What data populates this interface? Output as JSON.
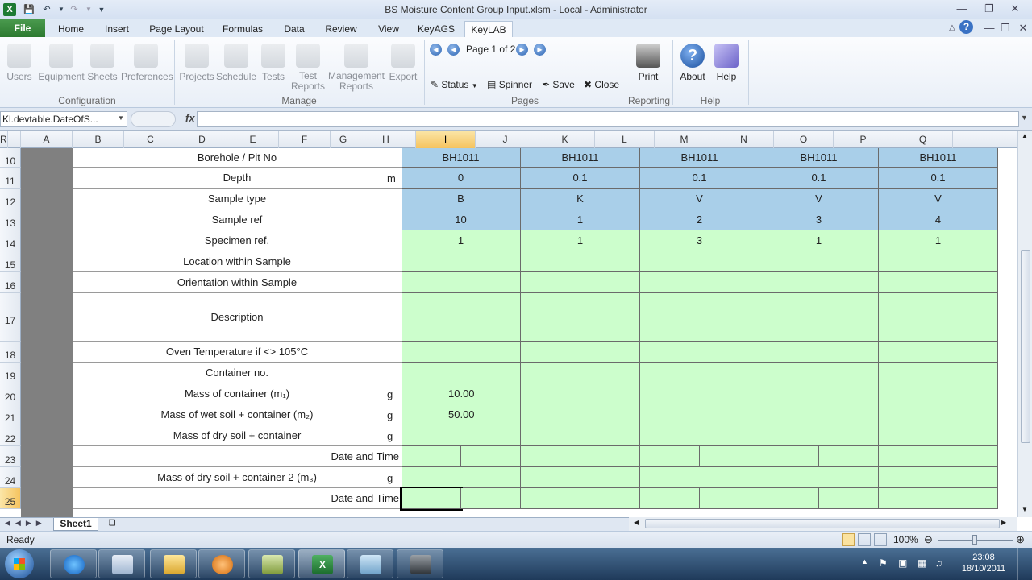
{
  "window": {
    "title": "BS Moisture Content Group Input.xlsm  -  Local - Administrator",
    "app_icon": "excel-icon",
    "buttons": [
      "minimize",
      "restore",
      "close"
    ]
  },
  "tabs": [
    "File",
    "Home",
    "Insert",
    "Page Layout",
    "Formulas",
    "Data",
    "Review",
    "View",
    "KeyAGS",
    "KeyLAB"
  ],
  "active_tab": "KeyLAB",
  "ribbon": {
    "configuration": {
      "group": "Configuration",
      "buttons": [
        "Users",
        "Equipment",
        "Sheets",
        "Preferences"
      ]
    },
    "manage": {
      "group": "Manage",
      "buttons": [
        "Projects",
        "Schedule",
        "Tests",
        "Test Reports",
        "Management Reports",
        "Export"
      ]
    },
    "pages": {
      "group": "Pages",
      "page_label": "Page 1 of 2",
      "status": "Status",
      "spinner": "Spinner",
      "save": "Save",
      "close": "Close"
    },
    "reporting": {
      "group": "Reporting",
      "print": "Print"
    },
    "help": {
      "group": "Help",
      "about": "About",
      "help": "Help"
    }
  },
  "formula_bar": {
    "name_box": "Kl.devtable.DateOfS...",
    "fx": "fx",
    "value": ""
  },
  "columns": [
    "A",
    "B",
    "C",
    "D",
    "E",
    "F",
    "G",
    "H",
    "I",
    "J",
    "K",
    "L",
    "M",
    "N",
    "O",
    "P",
    "Q",
    "R"
  ],
  "selected_column": "I",
  "selected_row": "25",
  "rows": [
    {
      "num": "10",
      "label": "Borehole / Pit No",
      "unit": "",
      "values": [
        "BH1011",
        "BH1011",
        "BH1011",
        "BH1011",
        "BH1011"
      ]
    },
    {
      "num": "11",
      "label": "Depth",
      "unit": "m",
      "values": [
        "0",
        "0.1",
        "0.1",
        "0.1",
        "0.1"
      ]
    },
    {
      "num": "12",
      "label": "Sample type",
      "unit": "",
      "values": [
        "B",
        "K",
        "V",
        "V",
        "V"
      ]
    },
    {
      "num": "13",
      "label": "Sample ref",
      "unit": "",
      "values": [
        "10",
        "1",
        "2",
        "3",
        "4"
      ]
    },
    {
      "num": "14",
      "label": "Specimen ref.",
      "unit": "",
      "values": [
        "1",
        "1",
        "3",
        "1",
        "1"
      ]
    },
    {
      "num": "15",
      "label": "Location within Sample",
      "unit": "",
      "values": [
        "",
        "",
        "",
        "",
        ""
      ]
    },
    {
      "num": "16",
      "label": "Orientation within Sample",
      "unit": "",
      "values": [
        "",
        "",
        "",
        "",
        ""
      ]
    },
    {
      "num": "17",
      "label": "Description",
      "unit": "",
      "values": [
        "",
        "",
        "",
        "",
        ""
      ]
    },
    {
      "num": "18",
      "label": "Oven Temperature if <> 105°C",
      "unit": "",
      "values": [
        "",
        "",
        "",
        "",
        ""
      ]
    },
    {
      "num": "19",
      "label": "Container no.",
      "unit": "",
      "values": [
        "",
        "",
        "",
        "",
        ""
      ]
    },
    {
      "num": "20",
      "label": "Mass of container (m₁)",
      "unit": "g",
      "values": [
        "10.00",
        "",
        "",
        "",
        ""
      ]
    },
    {
      "num": "21",
      "label": "Mass of wet soil + container (m₂)",
      "unit": "g",
      "values": [
        "50.00",
        "",
        "",
        "",
        ""
      ]
    },
    {
      "num": "22",
      "label": "Mass of dry soil + container",
      "unit": "g",
      "values": [
        "",
        "",
        "",
        "",
        ""
      ]
    },
    {
      "num": "23",
      "label": "Date and Time",
      "unit": "",
      "values": [
        "",
        "",
        "",
        "",
        ""
      ]
    },
    {
      "num": "24",
      "label": "Mass of dry soil + container 2 (m₃)",
      "unit": "g",
      "values": [
        "",
        "",
        "",
        "",
        ""
      ]
    },
    {
      "num": "25",
      "label": "Date and Time",
      "unit": "",
      "values": [
        "",
        "",
        "",
        "",
        ""
      ]
    }
  ],
  "sheet_tab": "Sheet1",
  "status": {
    "ready": "Ready",
    "zoom": "100%"
  },
  "taskbar": {
    "clock_time": "23:08",
    "clock_date": "18/10/2011"
  }
}
